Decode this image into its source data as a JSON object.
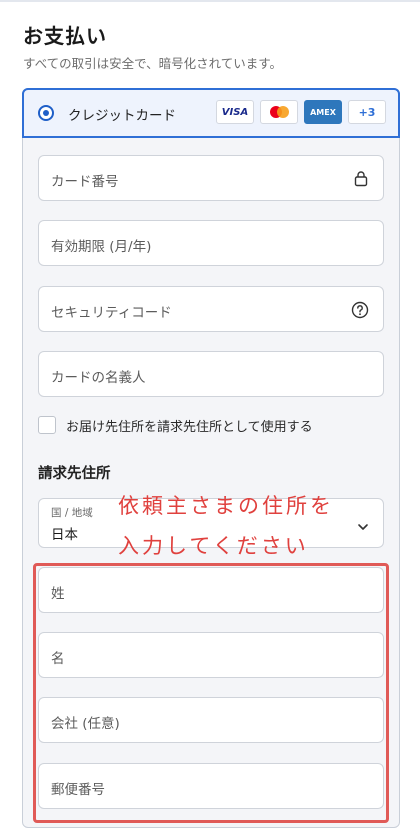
{
  "page": {
    "title": "お支払い",
    "subtitle": "すべての取引は安全で、暗号化されています。"
  },
  "payment_method": {
    "label": "クレジットカード",
    "brands": [
      "VISA",
      "AMEX",
      "+3"
    ],
    "icon_names": [
      "visa-logo",
      "mastercard-logo",
      "amex-logo"
    ]
  },
  "card_fields": {
    "number_placeholder": "カード番号",
    "expiry_placeholder": "有効期限 (月/年)",
    "security_placeholder": "セキュリティコード",
    "name_placeholder": "カードの名義人"
  },
  "billing": {
    "same_address_label": "お届け先住所を請求先住所として使用する",
    "same_address_checked": false,
    "section_title": "請求先住所",
    "country_label": "国 / 地域",
    "country_value": "日本",
    "last_name_placeholder": "姓",
    "first_name_placeholder": "名",
    "company_placeholder": "会社 (任意)",
    "postal_placeholder": "郵便番号"
  },
  "annotation": {
    "line1": "依頼主さまの住所を",
    "line2": "入力してください"
  },
  "colors": {
    "accent": "#2f6fd6",
    "annotation_red": "#e05a57"
  }
}
